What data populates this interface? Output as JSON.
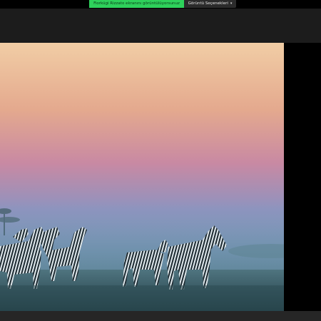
{
  "share_banner": {
    "text": "Fiorkügi Rizzato ekranını görüntülüyorsunuz",
    "view_options_label": "Görüntü Seçenekleri",
    "chevron_icon": "chevron-down-icon"
  },
  "shared_screen": {
    "content": "photo"
  },
  "colors": {
    "share_green": "#2ed15b",
    "header_dark": "#1c1c1c",
    "sky_top": "#f1cda5",
    "sky_mid": "#c889a3",
    "sky_low": "#7b98be",
    "ground": "#36575d"
  }
}
